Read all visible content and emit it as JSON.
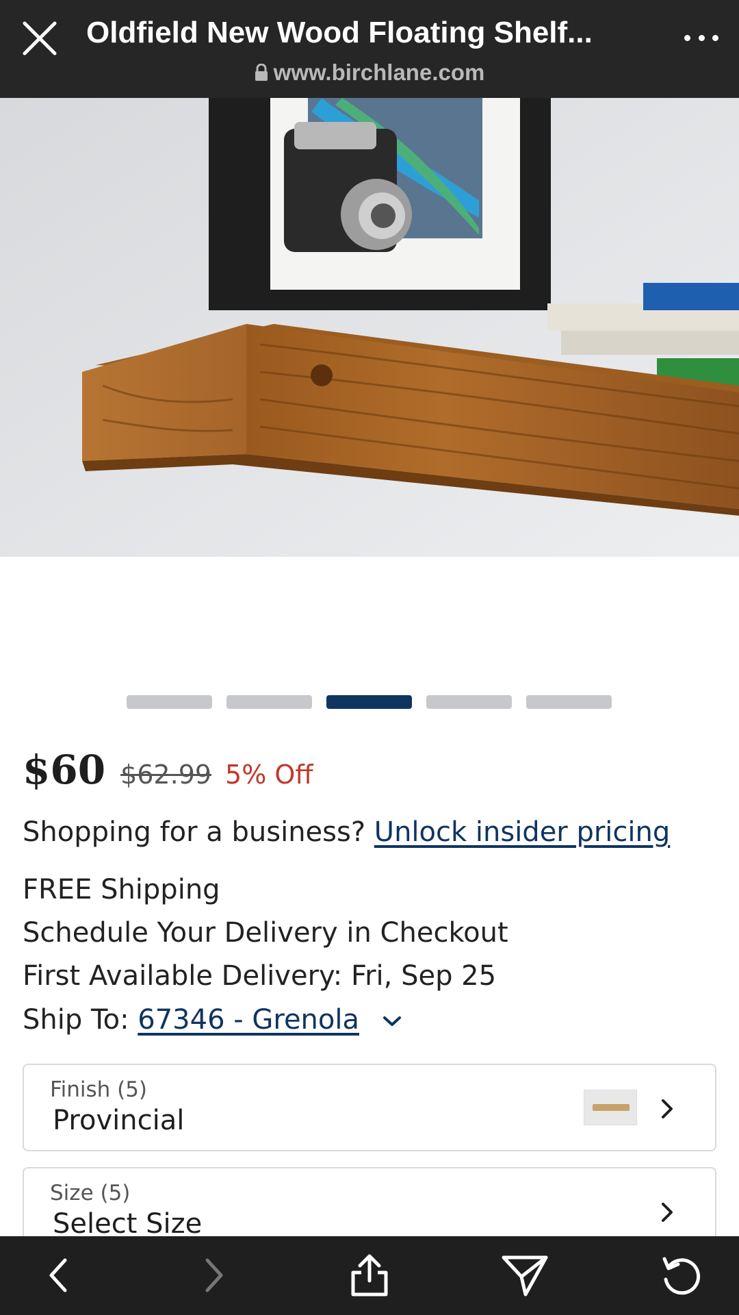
{
  "header": {
    "title": "Oldfield New Wood Floating Shelf...",
    "url": "www.birchlane.com"
  },
  "carousel": {
    "count": 5,
    "active_index": 2
  },
  "pricing": {
    "price": "$60",
    "original_price": "$62.99",
    "discount": "5% Off"
  },
  "business": {
    "prompt": "Shopping for a business?",
    "link": "Unlock insider pricing"
  },
  "shipping": {
    "free": "FREE Shipping",
    "schedule": "Schedule Your Delivery in Checkout",
    "first_delivery": "First Available Delivery: Fri, Sep 25",
    "ship_to_label": "Ship To:",
    "ship_to_value": "67346 - Grenola"
  },
  "options": [
    {
      "label": "Finish (5)",
      "value": "Provincial"
    },
    {
      "label": "Size (5)",
      "value": "Select Size"
    }
  ],
  "colors": {
    "accent": "#0f3460",
    "discount": "#c0392b",
    "topbar": "#262626",
    "toolbar": "#1f1f1f"
  },
  "icons": {
    "close": "close-icon",
    "more": "more-dots-icon",
    "lock": "lock-icon",
    "back": "back-arrow-icon",
    "forward": "forward-arrow-icon",
    "share": "share-icon",
    "send": "send-icon",
    "reload": "reload-icon"
  }
}
